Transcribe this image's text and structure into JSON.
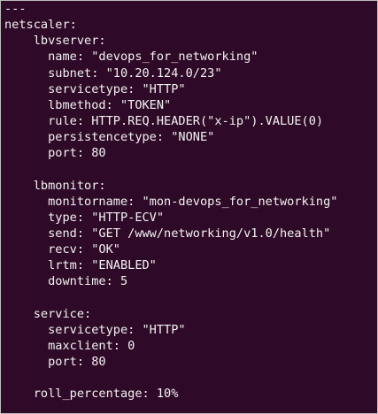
{
  "terminal": {
    "lines": [
      "---",
      "netscaler:",
      "    lbvserver:",
      "      name: \"devops_for_networking\"",
      "      subnet: \"10.20.124.0/23\"",
      "      servicetype: \"HTTP\"",
      "      lbmethod: \"TOKEN\"",
      "      rule: HTTP.REQ.HEADER(\"x-ip\").VALUE(0)",
      "      persistencetype: \"NONE\"",
      "      port: 80",
      "",
      "    lbmonitor:",
      "      monitorname: \"mon-devops_for_networking\"",
      "      type: \"HTTP-ECV\"",
      "      send: \"GET /www/networking/v1.0/health\"",
      "      recv: \"OK\"",
      "      lrtm: \"ENABLED\"",
      "      downtime: 5",
      "",
      "    service:",
      "      servicetype: \"HTTP\"",
      "      maxclient: 0",
      "      port: 80",
      "",
      "    roll_percentage: 10%"
    ]
  }
}
